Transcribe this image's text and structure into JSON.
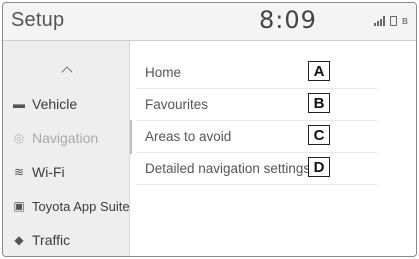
{
  "header": {
    "title": "Setup",
    "time": "8:09",
    "bt_glyph": "ʙ"
  },
  "sidebar": {
    "items": [
      {
        "label": "Vehicle",
        "icon": "car-icon",
        "glyph": "▬"
      },
      {
        "label": "Navigation",
        "icon": "navigation-icon",
        "glyph": "◎"
      },
      {
        "label": "Wi-Fi",
        "icon": "wifi-icon",
        "glyph": "≋"
      },
      {
        "label": "Toyota App Suite",
        "icon": "app-suite-icon",
        "glyph": "▣"
      },
      {
        "label": "Traffic",
        "icon": "traffic-icon",
        "glyph": "◆"
      }
    ]
  },
  "main": {
    "items": [
      {
        "label": "Home",
        "badge": "A"
      },
      {
        "label": "Favourites",
        "badge": "B"
      },
      {
        "label": "Areas to avoid",
        "badge": "C"
      },
      {
        "label": "Detailed navigation settings",
        "badge": "D"
      }
    ]
  }
}
